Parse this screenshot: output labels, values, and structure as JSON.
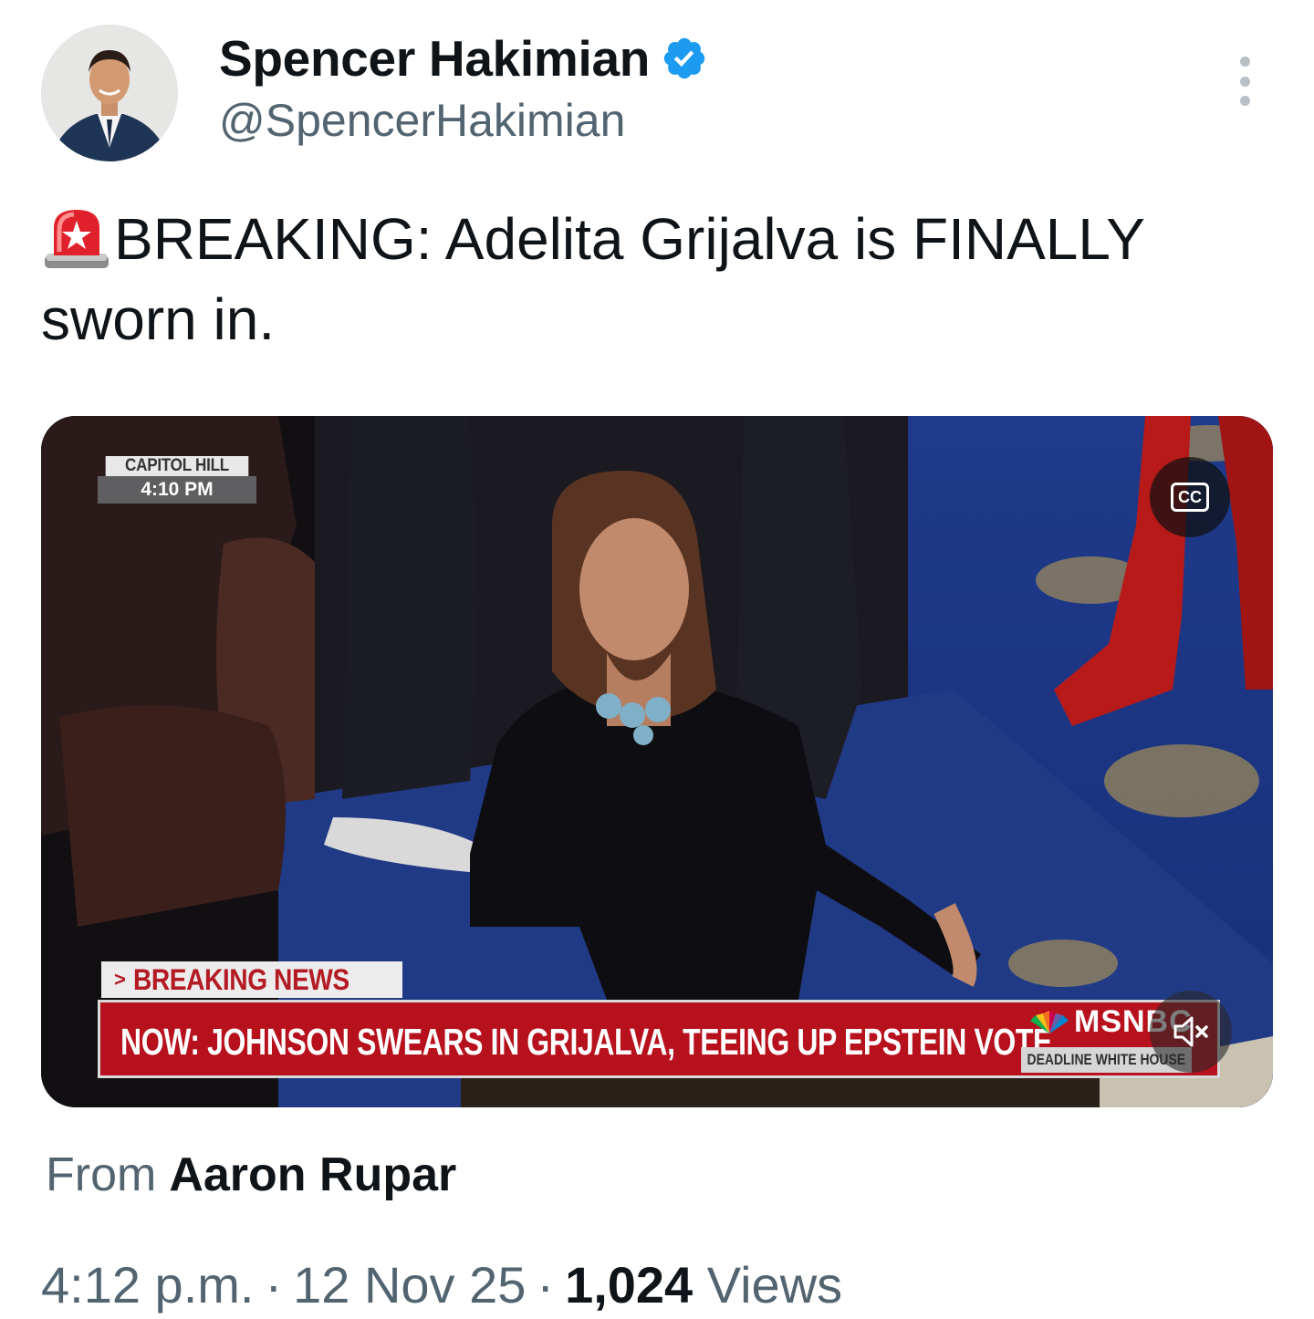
{
  "author": {
    "display_name": "Spencer Hakimian",
    "handle": "@SpencerHakimian",
    "verified": true,
    "verified_color": "#1d9bf0",
    "avatar_icon": "profile-photo"
  },
  "tweet": {
    "emoji": "rotating-light-siren",
    "text": "BREAKING: Adelita Grijalva is FINALLY sworn in."
  },
  "video": {
    "location_label": "CAPITOL HILL",
    "time_label": "4:10 PM",
    "cc_label": "CC",
    "breaking_tag": "BREAKING NEWS",
    "chyron": "NOW: JOHNSON SWEARS IN GRIJALVA, TEEING UP EPSTEIN VOTE",
    "network": "MSNBC",
    "show": "DEADLINE  WHITE HOUSE",
    "muted": true
  },
  "attribution": {
    "label": "From",
    "name": "Aaron Rupar"
  },
  "meta": {
    "time": "4:12 p.m.",
    "separator": "·",
    "date": "12 Nov 25",
    "views_count": "1,024",
    "views_label": "Views"
  },
  "colors": {
    "text_primary": "#0f1419",
    "text_secondary": "#536471",
    "chyron_red": "#b7111d"
  }
}
